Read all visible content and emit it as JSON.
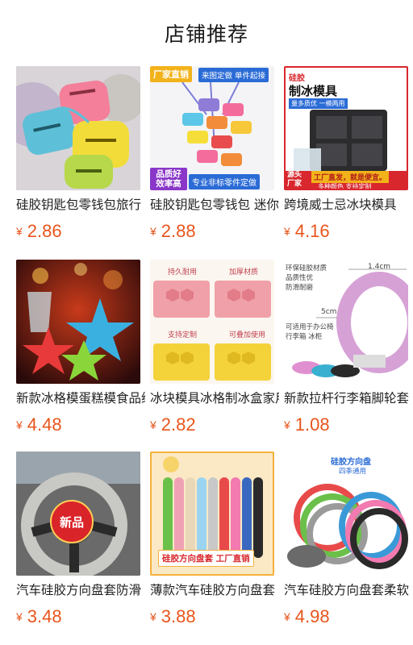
{
  "header": {
    "title": "店铺推荐"
  },
  "products": [
    {
      "title": "硅胶钥匙包零钱包旅行",
      "currency": "¥",
      "price": "2.86"
    },
    {
      "title": "硅胶钥匙包零钱包 迷你",
      "currency": "¥",
      "price": "2.88",
      "badges": {
        "top_left": "厂家直销",
        "top_right": "来图定做  单件起接",
        "bottom_left": "品质好 效率高",
        "bottom_right": "专业非标零件定做"
      }
    },
    {
      "title": "跨境威士忌冰块模具",
      "currency": "¥",
      "price": "4.16",
      "badges": {
        "brand": "硅胶",
        "headline": "制冰模具",
        "sub": "量多质优 一模两用",
        "bottom_left": "源头 厂家",
        "bottom_mid": "工厂直发，就是便宜。",
        "bottom_sub": "多种颜色 支持定制"
      }
    },
    {
      "title": "新款冰格模蛋糕模食品级",
      "currency": "¥",
      "price": "4.48"
    },
    {
      "title": "冰块模具冰格制冰盒家用",
      "currency": "¥",
      "price": "2.82",
      "badges": {
        "q1": "持久耐用",
        "q2": "加厚材质",
        "q3": "支持定制",
        "q4": "可叠加使用"
      }
    },
    {
      "title": "新款拉杆行李箱脚轮套",
      "currency": "¥",
      "price": "1.08",
      "badges": {
        "line1": "环保硅胶材质",
        "line2": "品质性优",
        "line3": "防滑耐磨",
        "dim1": "1.4cm",
        "dim2": "5cm",
        "use": "可适用于办公椅 行李箱 冰柜"
      }
    },
    {
      "title": "汽车硅胶方向盘套防滑",
      "currency": "¥",
      "price": "3.48",
      "badges": {
        "new": "新品"
      }
    },
    {
      "title": "薄款汽车硅胶方向盘套",
      "currency": "¥",
      "price": "3.88",
      "badges": {
        "bottom": "硅胶方向盘套  工厂直销"
      }
    },
    {
      "title": "汽车硅胶方向盘套柔软",
      "currency": "¥",
      "price": "4.98",
      "badges": {
        "top": "硅胶方向盘",
        "sub": "四季通用"
      }
    }
  ],
  "colors": {
    "price": "#e8551c",
    "title": "#1a1a1a"
  }
}
